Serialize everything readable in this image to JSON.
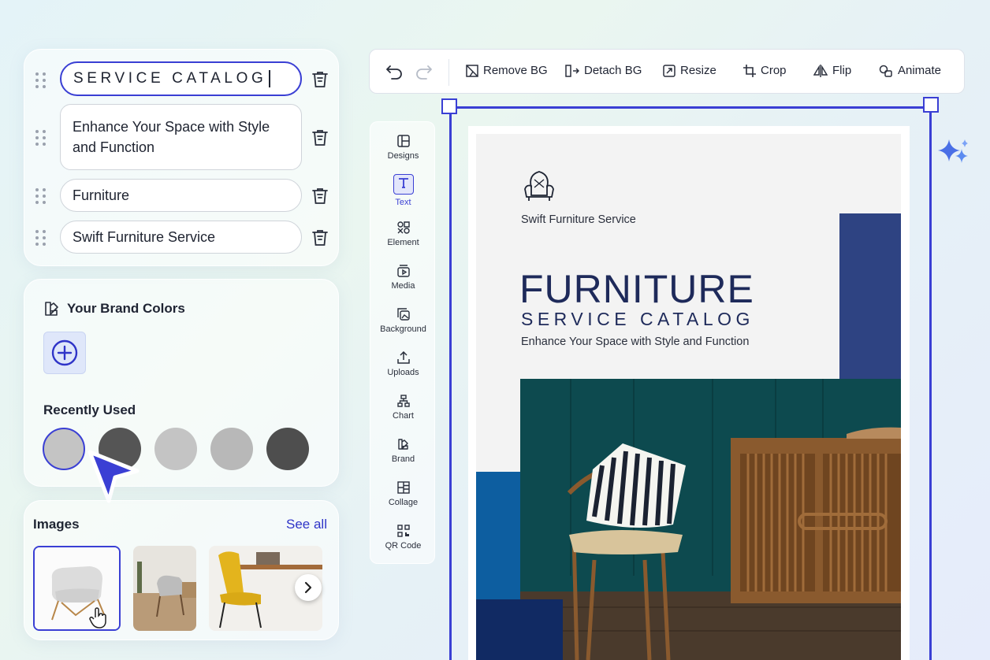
{
  "fields": [
    {
      "value": "SERVICE CATALOG"
    },
    {
      "value": "Enhance Your Space with Style and Function"
    },
    {
      "value": "Furniture"
    },
    {
      "value": "Swift Furniture Service"
    }
  ],
  "brand": {
    "title": "Your Brand Colors",
    "recent_title": "Recently Used",
    "recent_colors": [
      "#c4c4c4",
      "#555555",
      "#c4c4c4",
      "#b8b8b8",
      "#4e4e4e"
    ]
  },
  "images": {
    "title": "Images",
    "see_all": "See all"
  },
  "toolbar": {
    "remove_bg": "Remove BG",
    "detach_bg": "Detach BG",
    "resize": "Resize",
    "crop": "Crop",
    "flip": "Flip",
    "animate": "Animate"
  },
  "rail": [
    {
      "label": "Designs",
      "icon": "designs-icon"
    },
    {
      "label": "Text",
      "icon": "text-icon"
    },
    {
      "label": "Element",
      "icon": "element-icon"
    },
    {
      "label": "Media",
      "icon": "media-icon"
    },
    {
      "label": "Background",
      "icon": "background-icon"
    },
    {
      "label": "Uploads",
      "icon": "upload-icon"
    },
    {
      "label": "Chart",
      "icon": "chart-icon"
    },
    {
      "label": "Brand",
      "icon": "brand-icon"
    },
    {
      "label": "Collage",
      "icon": "collage-icon"
    },
    {
      "label": "QR Code",
      "icon": "qr-code-icon"
    }
  ],
  "poster": {
    "brand": "Swift Furniture Service",
    "title": "FURNITURE",
    "subtitle": "SERVICE CATALOG",
    "tagline": "Enhance Your Space with Style and Function"
  },
  "colors": {
    "accent": "#3a3fd4",
    "navy": "#2e4382",
    "teal": "#0d4a4f",
    "blue": "#0d5ea0"
  }
}
